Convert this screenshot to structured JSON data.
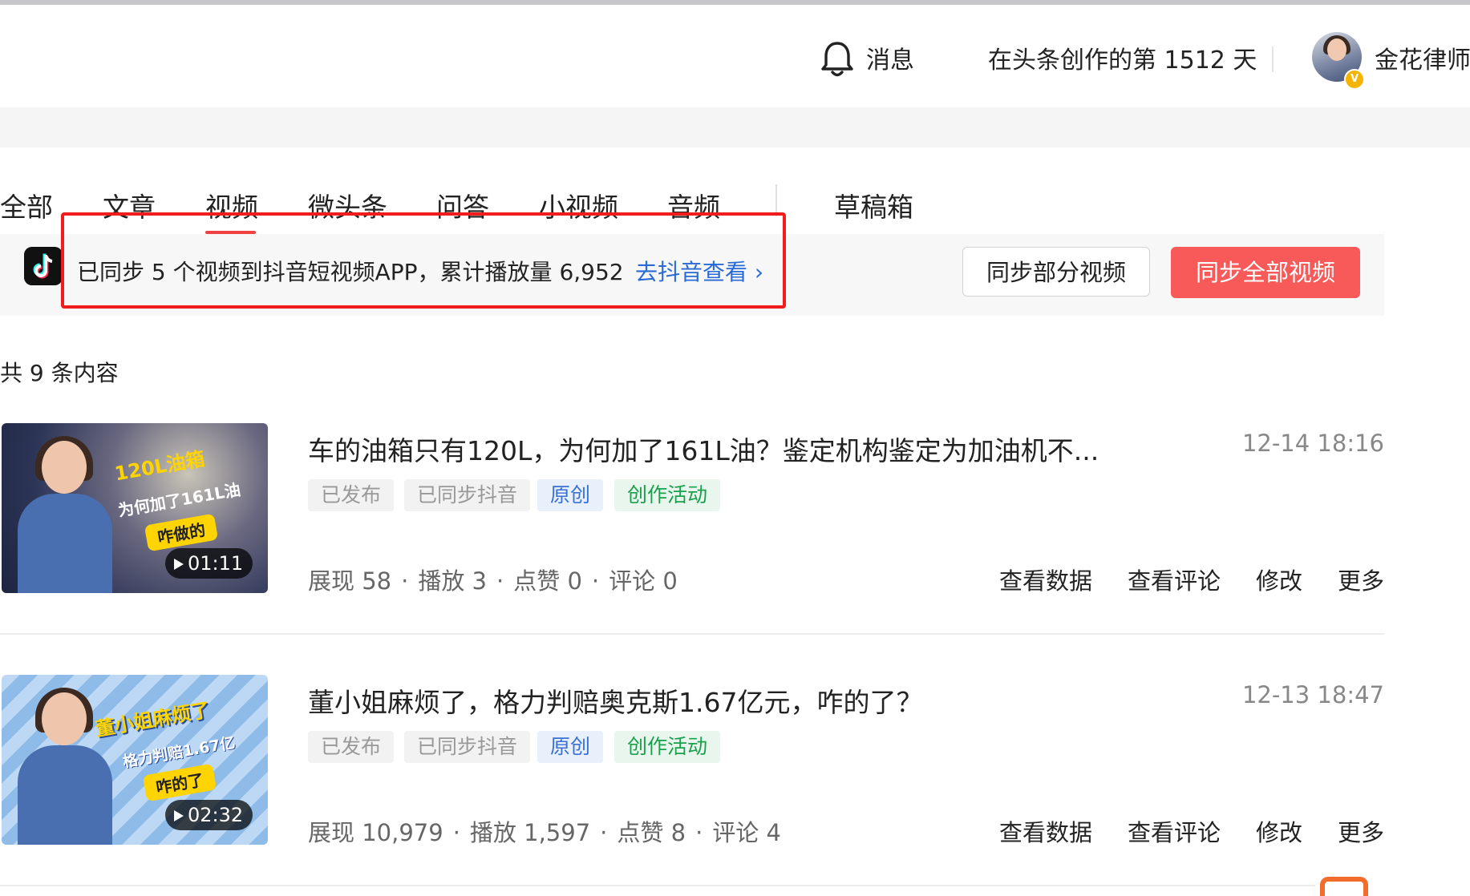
{
  "header": {
    "messages_label": "消息",
    "days_text": "在头条创作的第 1512 天",
    "username": "金花律师",
    "verified_badge": "V"
  },
  "tabs": [
    {
      "label": "全部",
      "active": false
    },
    {
      "label": "文章",
      "active": false
    },
    {
      "label": "视频",
      "active": true
    },
    {
      "label": "微头条",
      "active": false
    },
    {
      "label": "问答",
      "active": false
    },
    {
      "label": "小视频",
      "active": false
    },
    {
      "label": "音频",
      "active": false
    },
    {
      "label": "草稿箱",
      "active": false
    }
  ],
  "sync_banner": {
    "text": "已同步 5 个视频到抖音短视频APP，累计播放量 6,952",
    "link": "去抖音查看 ›",
    "btn_partial": "同步部分视频",
    "btn_all": "同步全部视频"
  },
  "list": {
    "count_text": "共 9 条内容",
    "items": [
      {
        "title": "车的油箱只有120L，为何加了161L油？鉴定机构鉴定为加油机不...",
        "date": "12-14 18:16",
        "tags": [
          "已发布",
          "已同步抖音",
          "原创",
          "创作活动"
        ],
        "stats": [
          "展现 58",
          "播放 3",
          "点赞 0",
          "评论 0"
        ],
        "actions": [
          "查看数据",
          "查看评论",
          "修改",
          "更多"
        ],
        "duration": "01:11",
        "thumb_lines": [
          "120L油箱",
          "为何加了161L油",
          "咋做的"
        ]
      },
      {
        "title": "董小姐麻烦了，格力判赔奥克斯1.67亿元，咋的了？",
        "date": "12-13 18:47",
        "tags": [
          "已发布",
          "已同步抖音",
          "原创",
          "创作活动"
        ],
        "stats": [
          "展现 10,979",
          "播放 1,597",
          "点赞 8",
          "评论 4"
        ],
        "actions": [
          "查看数据",
          "查看评论",
          "修改",
          "更多"
        ],
        "duration": "02:32",
        "thumb_lines": [
          "董小姐麻烦了",
          "格力判赔1.67亿",
          "咋的了"
        ]
      }
    ]
  },
  "colors": {
    "accent_red": "#f85959",
    "tab_underline": "#f04142",
    "link_blue": "#2a6ad6",
    "highlight_box": "#f11d1d"
  },
  "icons": {
    "bell": "bell-icon",
    "tiktok": "tiktok-logo-icon",
    "play": "play-icon",
    "chevron": "chevron-right-icon"
  }
}
